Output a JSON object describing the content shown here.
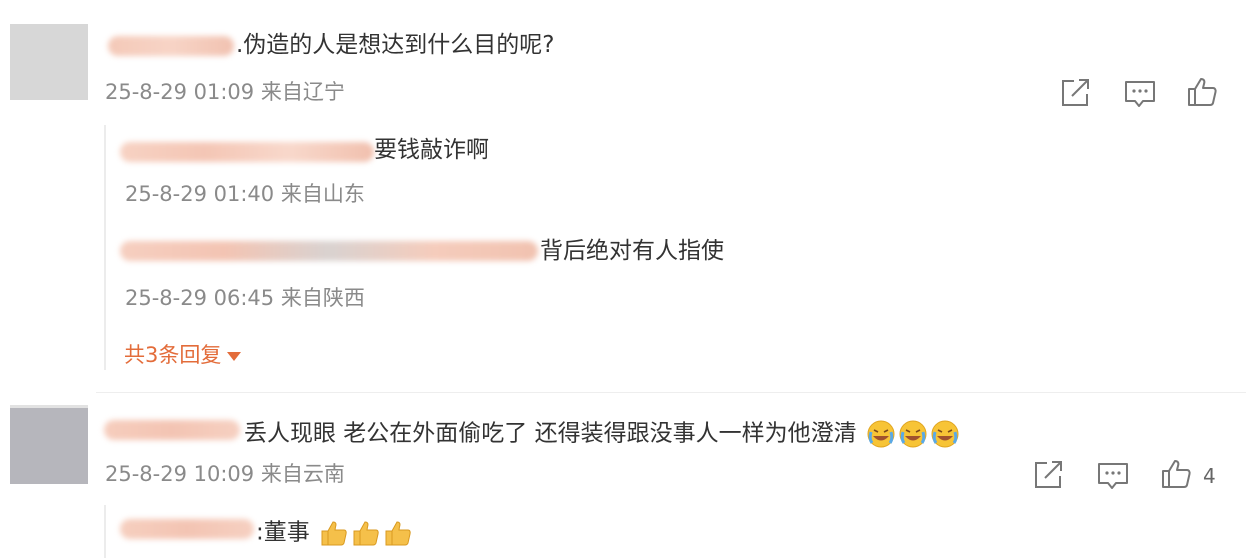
{
  "comments": [
    {
      "text": ".伪造的人是想达到什么目的呢?",
      "meta": "25-8-29 01:09 来自辽宁",
      "replies": [
        {
          "text": "要钱敲诈啊",
          "meta": "25-8-29 01:40 来自山东"
        },
        {
          "text": "背后绝对有人指使",
          "meta": "25-8-29 06:45 来自陕西"
        }
      ],
      "more_replies": "共3条回复"
    },
    {
      "text": "丢人现眼 老公在外面偷吃了 还得装得跟没事人一样为他澄清",
      "meta": "25-8-29 10:09 来自云南",
      "like_count": "4",
      "replies": [
        {
          "text": ":董事"
        }
      ]
    }
  ],
  "icons": {
    "share": "share-icon",
    "comment": "comment-icon",
    "like": "thumbs-up-icon",
    "crying": "crying-laugh-emoji",
    "thumbsup_emoji": "thumbs-up-emoji"
  },
  "colors": {
    "accent": "#e36c3a",
    "meta": "#8a8a8a",
    "text": "#333333"
  }
}
